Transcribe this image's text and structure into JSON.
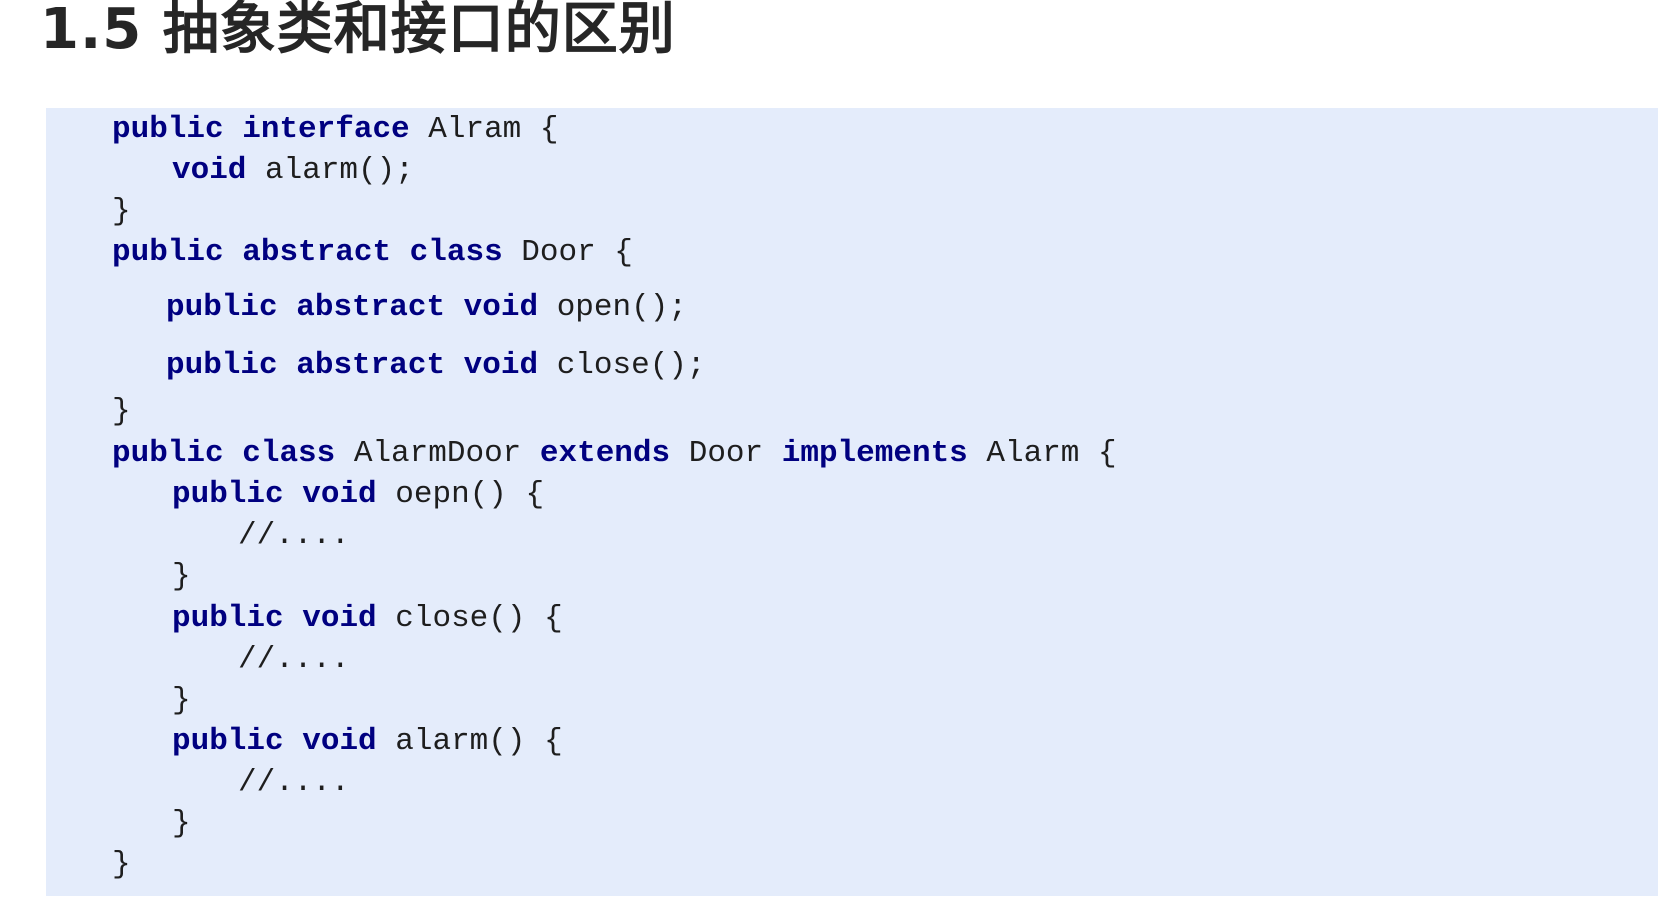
{
  "title": "1.5 抽象类和接口的区别",
  "code": {
    "lines": [
      {
        "indent": 0,
        "tokens": [
          {
            "t": "kw",
            "v": "public"
          },
          {
            "t": "txt",
            "v": " "
          },
          {
            "t": "kw",
            "v": "interface"
          },
          {
            "t": "txt",
            "v": " Alram {"
          }
        ]
      },
      {
        "indent": 1,
        "tokens": [
          {
            "t": "kw",
            "v": "void"
          },
          {
            "t": "txt",
            "v": " alarm();"
          }
        ]
      },
      {
        "indent": 0,
        "tokens": [
          {
            "t": "txt",
            "v": "}"
          }
        ]
      },
      {
        "indent": 0,
        "tokens": [
          {
            "t": "kw",
            "v": "public"
          },
          {
            "t": "txt",
            "v": " "
          },
          {
            "t": "kw",
            "v": "abstract"
          },
          {
            "t": "txt",
            "v": " "
          },
          {
            "t": "kw",
            "v": "class"
          },
          {
            "t": "txt",
            "v": " Door {"
          }
        ]
      },
      {
        "indent": 1,
        "tokens": [
          {
            "t": "kw",
            "v": "public"
          },
          {
            "t": "txt",
            "v": " "
          },
          {
            "t": "kw",
            "v": "abstract"
          },
          {
            "t": "txt",
            "v": " "
          },
          {
            "t": "kw",
            "v": "void"
          },
          {
            "t": "txt",
            "v": " open();"
          }
        ]
      },
      {
        "indent": 1,
        "tokens": [
          {
            "t": "kw",
            "v": "public"
          },
          {
            "t": "txt",
            "v": " "
          },
          {
            "t": "kw",
            "v": "abstract"
          },
          {
            "t": "txt",
            "v": " "
          },
          {
            "t": "kw",
            "v": "void"
          },
          {
            "t": "txt",
            "v": " close();"
          }
        ]
      },
      {
        "indent": 0,
        "tokens": [
          {
            "t": "txt",
            "v": "}"
          }
        ]
      },
      {
        "indent": 0,
        "tokens": [
          {
            "t": "kw",
            "v": "public"
          },
          {
            "t": "txt",
            "v": " "
          },
          {
            "t": "kw",
            "v": "class"
          },
          {
            "t": "txt",
            "v": " AlarmDoor "
          },
          {
            "t": "kw",
            "v": "extends"
          },
          {
            "t": "txt",
            "v": " Door "
          },
          {
            "t": "kw",
            "v": "implements"
          },
          {
            "t": "txt",
            "v": " Alarm {"
          }
        ]
      },
      {
        "indent": 1,
        "tokens": [
          {
            "t": "kw",
            "v": "public"
          },
          {
            "t": "txt",
            "v": " "
          },
          {
            "t": "kw",
            "v": "void"
          },
          {
            "t": "txt",
            "v": " oepn() {"
          }
        ]
      },
      {
        "indent": 2,
        "tokens": [
          {
            "t": "txt",
            "v": "//...."
          }
        ]
      },
      {
        "indent": 1,
        "tokens": [
          {
            "t": "txt",
            "v": "}"
          }
        ]
      },
      {
        "indent": 1,
        "tokens": [
          {
            "t": "kw",
            "v": "public"
          },
          {
            "t": "txt",
            "v": " "
          },
          {
            "t": "kw",
            "v": "void"
          },
          {
            "t": "txt",
            "v": " close() {"
          }
        ]
      },
      {
        "indent": 2,
        "tokens": [
          {
            "t": "txt",
            "v": "//...."
          }
        ]
      },
      {
        "indent": 1,
        "tokens": [
          {
            "t": "txt",
            "v": "}"
          }
        ]
      },
      {
        "indent": 1,
        "tokens": [
          {
            "t": "kw",
            "v": "public"
          },
          {
            "t": "txt",
            "v": " "
          },
          {
            "t": "kw",
            "v": "void"
          },
          {
            "t": "txt",
            "v": " alarm() {"
          }
        ]
      },
      {
        "indent": 2,
        "tokens": [
          {
            "t": "txt",
            "v": "//...."
          }
        ]
      },
      {
        "indent": 1,
        "tokens": [
          {
            "t": "txt",
            "v": "}"
          }
        ]
      },
      {
        "indent": 0,
        "tokens": [
          {
            "t": "txt",
            "v": "}"
          }
        ]
      }
    ]
  },
  "colors": {
    "keyword": "#000080",
    "text": "#1e1e1e",
    "panel_background": "#e4ecfb",
    "title": "#262626"
  }
}
